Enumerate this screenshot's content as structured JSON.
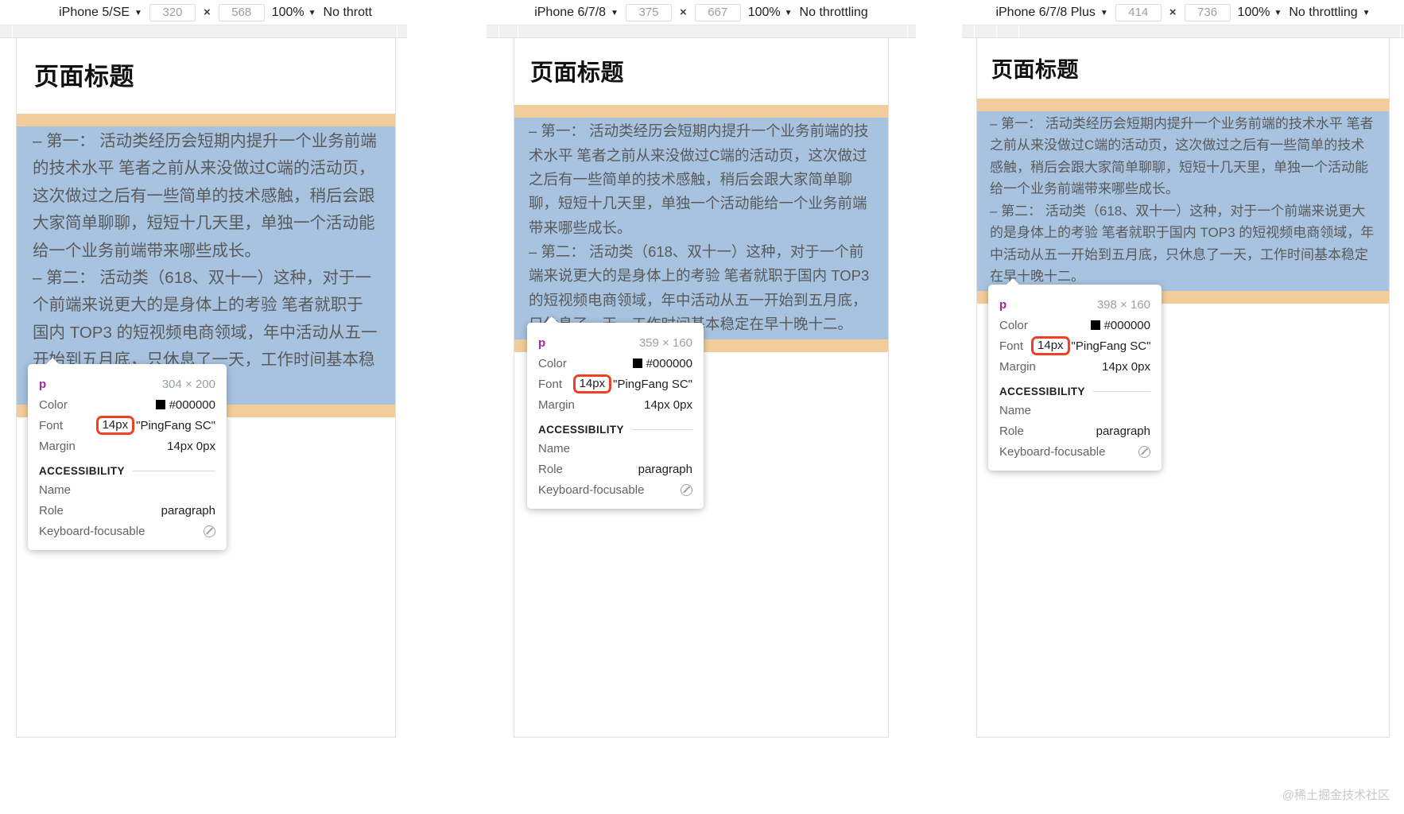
{
  "panels": [
    {
      "id": "iphone-5-se",
      "toolbar": {
        "device": "iPhone 5/SE",
        "width": "320",
        "height": "568",
        "times": "×",
        "zoom": "100%",
        "throttling": "No thrott",
        "caret": "▼"
      },
      "page": {
        "title": "页面标题",
        "paragraphs": [
          "– 第一： 活动类经历会短期内提升一个业务前端的技术水平 笔者之前从来没做过C端的活动页，这次做过之后有一些简单的技术感触，稍后会跟大家简单聊聊，短短十几天里，单独一个活动能给一个业务前端带来哪些成长。",
          "– 第二： 活动类（618、双十一）这种，对于一个前端来说更大的是身体上的考验 笔者就职于国内 TOP3 的短视频电商领域，年中活动从五一开始到五月底，只休息了一天，工作时间基本稳定在早十晚十二。"
        ]
      },
      "tooltip": {
        "tag": "p",
        "dimensions": "304 × 200",
        "color_label": "Color",
        "color_value": "#000000",
        "font_label": "Font",
        "font_size": "14px",
        "font_family": "\"PingFang SC\"",
        "margin_label": "Margin",
        "margin_value": "14px 0px",
        "accessibility_title": "ACCESSIBILITY",
        "name_label": "Name",
        "name_value": "",
        "role_label": "Role",
        "role_value": "paragraph",
        "focusable_label": "Keyboard-focusable",
        "focusable_value": "no-entry-icon"
      }
    },
    {
      "id": "iphone-6-7-8",
      "toolbar": {
        "device": "iPhone 6/7/8",
        "width": "375",
        "height": "667",
        "times": "×",
        "zoom": "100%",
        "throttling": "No throttling",
        "caret": "▼"
      },
      "page": {
        "title": "页面标题",
        "paragraphs": [
          "– 第一： 活动类经历会短期内提升一个业务前端的技术水平 笔者之前从来没做过C端的活动页，这次做过之后有一些简单的技术感触，稍后会跟大家简单聊聊，短短十几天里，单独一个活动能给一个业务前端带来哪些成长。",
          "– 第二： 活动类（618、双十一）这种，对于一个前端来说更大的是身体上的考验 笔者就职于国内 TOP3 的短视频电商领域，年中活动从五一开始到五月底，只休息了一天，工作时间基本稳定在早十晚十二。"
        ]
      },
      "tooltip": {
        "tag": "p",
        "dimensions": "359 × 160",
        "color_label": "Color",
        "color_value": "#000000",
        "font_label": "Font",
        "font_size": "14px",
        "font_family": "\"PingFang SC\"",
        "margin_label": "Margin",
        "margin_value": "14px 0px",
        "accessibility_title": "ACCESSIBILITY",
        "name_label": "Name",
        "name_value": "",
        "role_label": "Role",
        "role_value": "paragraph",
        "focusable_label": "Keyboard-focusable",
        "focusable_value": "no-entry-icon"
      }
    },
    {
      "id": "iphone-6-7-8-plus",
      "toolbar": {
        "device": "iPhone 6/7/8 Plus",
        "width": "414",
        "height": "736",
        "times": "×",
        "zoom": "100%",
        "throttling": "No throttling",
        "caret": "▼"
      },
      "page": {
        "title": "页面标题",
        "paragraphs": [
          "– 第一： 活动类经历会短期内提升一个业务前端的技术水平 笔者之前从来没做过C端的活动页，这次做过之后有一些简单的技术感触，稍后会跟大家简单聊聊，短短十几天里，单独一个活动能给一个业务前端带来哪些成长。",
          "– 第二： 活动类（618、双十一）这种，对于一个前端来说更大的是身体上的考验 笔者就职于国内 TOP3 的短视频电商领域，年中活动从五一开始到五月底，只休息了一天，工作时间基本稳定在早十晚十二。"
        ]
      },
      "tooltip": {
        "tag": "p",
        "dimensions": "398 × 160",
        "color_label": "Color",
        "color_value": "#000000",
        "font_label": "Font",
        "font_size": "14px",
        "font_family": "\"PingFang SC\"",
        "margin_label": "Margin",
        "margin_value": "14px 0px",
        "accessibility_title": "ACCESSIBILITY",
        "name_label": "Name",
        "name_value": "",
        "role_label": "Role",
        "role_value": "paragraph",
        "focusable_label": "Keyboard-focusable",
        "focusable_value": "no-entry-icon"
      }
    }
  ],
  "watermark": "@稀土掘金技术社区",
  "colors": {
    "highlight_margin": "#f2cc9a",
    "highlight_content": "#a7c3e0",
    "annotation": "#f04124",
    "tag": "#a0299c",
    "swatch": "#000000"
  }
}
